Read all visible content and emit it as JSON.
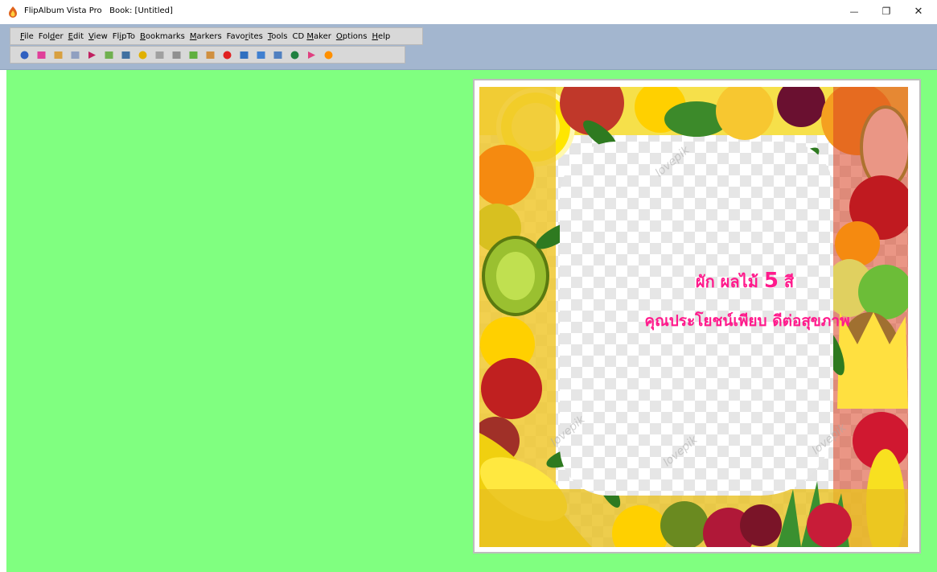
{
  "window": {
    "title": "FlipAlbum Vista Pro   Book: [Untitled]",
    "minimize_glyph": "—",
    "maximize_glyph": "❐",
    "close_glyph": "✕"
  },
  "menu": {
    "items": [
      {
        "pre": "",
        "ul": "F",
        "post": "ile"
      },
      {
        "pre": "Fol",
        "ul": "d",
        "post": "er"
      },
      {
        "pre": "",
        "ul": "E",
        "post": "dit"
      },
      {
        "pre": "",
        "ul": "V",
        "post": "iew"
      },
      {
        "pre": "Fl",
        "ul": "i",
        "post": "pTo"
      },
      {
        "pre": "",
        "ul": "B",
        "post": "ookmarks"
      },
      {
        "pre": "",
        "ul": "M",
        "post": "arkers"
      },
      {
        "pre": "Favo",
        "ul": "r",
        "post": "ites"
      },
      {
        "pre": "",
        "ul": "T",
        "post": "ools"
      },
      {
        "pre": "CD ",
        "ul": "M",
        "post": "aker"
      },
      {
        "pre": "",
        "ul": "O",
        "post": "ptions"
      },
      {
        "pre": "",
        "ul": "H",
        "post": "elp"
      }
    ]
  },
  "toolbar": {
    "buttons": [
      {
        "name": "eye-icon",
        "color": "#3060c0"
      },
      {
        "name": "pink-book-icon",
        "color": "#e0409a"
      },
      {
        "name": "open-book-icon",
        "color": "#d8a040"
      },
      {
        "name": "single-page-icon",
        "color": "#90a0c0"
      },
      {
        "name": "arrow-right-icon",
        "color": "#c02060"
      },
      {
        "name": "page-flip-icon",
        "color": "#70b050"
      },
      {
        "name": "save-book-icon",
        "color": "#4070a0"
      },
      {
        "name": "add-icon",
        "color": "#e0b000"
      },
      {
        "name": "wand-icon",
        "color": "#a0a0a0"
      },
      {
        "name": "pages-icon",
        "color": "#909090"
      },
      {
        "name": "brush-icon",
        "color": "#60b040"
      },
      {
        "name": "album-icon",
        "color": "#d09040"
      },
      {
        "name": "stop-icon",
        "color": "#e02020"
      },
      {
        "name": "screen-icon",
        "color": "#3070c0"
      },
      {
        "name": "slideshow-icon",
        "color": "#4080d0"
      },
      {
        "name": "image-icon",
        "color": "#5080c0"
      },
      {
        "name": "globe-icon",
        "color": "#208040"
      },
      {
        "name": "pointer-icon",
        "color": "#e04080"
      },
      {
        "name": "sun-icon",
        "color": "#ff9000"
      }
    ]
  },
  "page": {
    "line1_pre": "ผัก ผลไม้ ",
    "line1_num": "5",
    "line1_post": " สี",
    "line2": "คุณประโยชน์เพียบ ดีต่อสุขภาพ",
    "watermark": "lovepik",
    "text_color": "#ff1a8c"
  },
  "colors": {
    "workspace": "#80ff80",
    "chrome": "#a3b6cf"
  }
}
